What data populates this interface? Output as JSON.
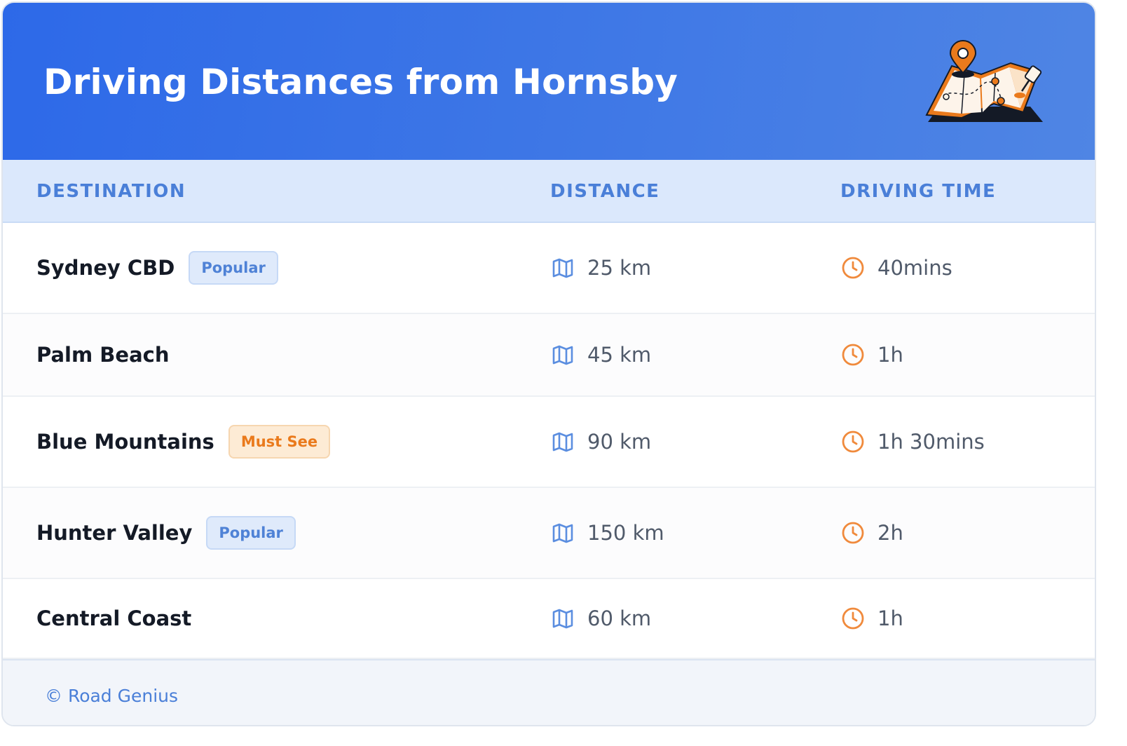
{
  "header": {
    "title": "Driving Distances from Hornsby"
  },
  "columns": {
    "destination": "DESTINATION",
    "distance": "DISTANCE",
    "driving_time": "DRIVING TIME"
  },
  "rows": [
    {
      "destination": "Sydney CBD",
      "badge": "Popular",
      "badge_type": "popular",
      "distance": "25 km",
      "time": "40mins"
    },
    {
      "destination": "Palm Beach",
      "badge": "",
      "badge_type": "",
      "distance": "45 km",
      "time": "1h"
    },
    {
      "destination": "Blue Mountains",
      "badge": "Must See",
      "badge_type": "mustsee",
      "distance": "90 km",
      "time": "1h 30mins"
    },
    {
      "destination": "Hunter Valley",
      "badge": "Popular",
      "badge_type": "popular",
      "distance": "150 km",
      "time": "2h"
    },
    {
      "destination": "Central Coast",
      "badge": "",
      "badge_type": "",
      "distance": "60 km",
      "time": "1h"
    }
  ],
  "icons": {
    "distance": "map-icon",
    "time": "clock-icon",
    "header": "map-pin-illustration"
  },
  "footer": {
    "text": "© Road Genius"
  },
  "colors": {
    "header_gradient_start": "#2d69e8",
    "header_gradient_end": "#4f85e4",
    "column_header_text": "#4a7fd8",
    "popular_badge": "#4f82d6",
    "must_see_badge": "#ea7a1c",
    "clock_icon": "#f08a3c",
    "map_icon": "#5b8ee0"
  }
}
